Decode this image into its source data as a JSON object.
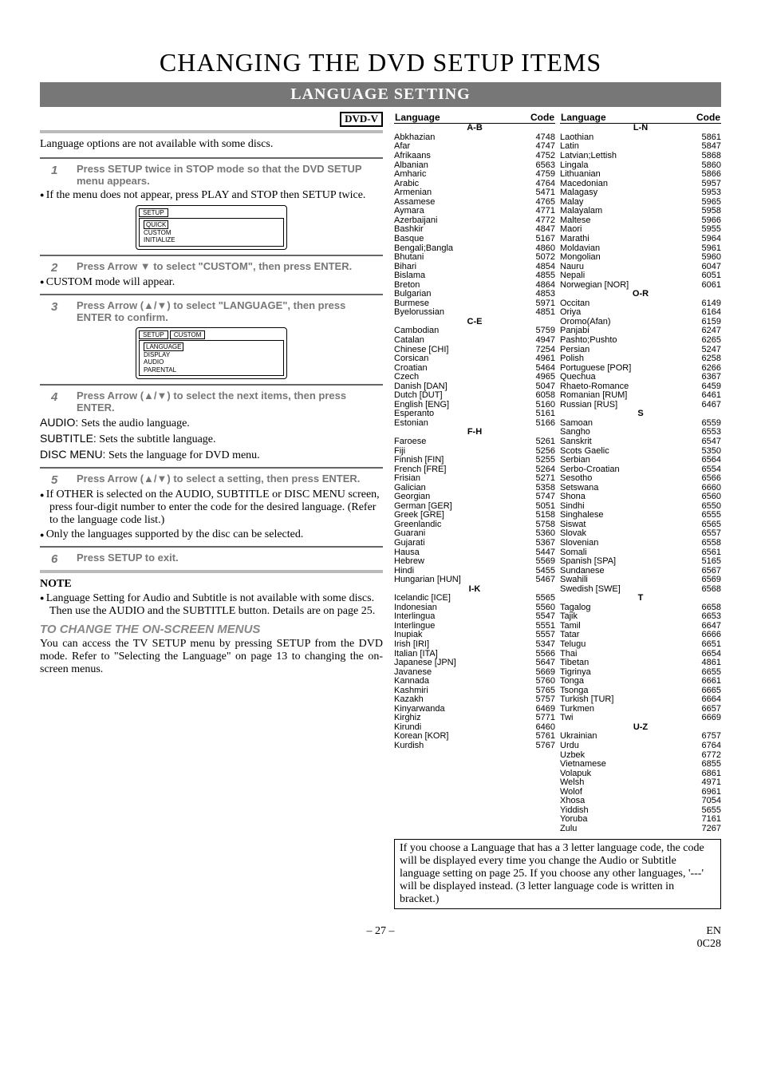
{
  "main_title": "CHANGING THE DVD SETUP ITEMS",
  "sub_title": "LANGUAGE SETTING",
  "dvd_box": "DVD-V",
  "intro": "Language options are not available with some discs.",
  "step1": "Press SETUP twice in STOP mode so that the DVD SETUP menu appears.",
  "bullet1": "If the menu does not appear, press PLAY and STOP then SETUP twice.",
  "osd1": {
    "tab": "SETUP",
    "items": [
      "QUICK",
      "CUSTOM",
      "INITIALIZE"
    ],
    "highlight": 0
  },
  "step2": "Press Arrow ▼ to select \"CUSTOM\", then press ENTER.",
  "bullet2": "CUSTOM mode will appear.",
  "step3": "Press Arrow (▲/▼) to select \"LANGUAGE\", then press ENTER to confirm.",
  "osd2": {
    "tab": "SETUP",
    "tab2": "CUSTOM",
    "items": [
      "LANGUAGE",
      "DISPLAY",
      "AUDIO",
      "PARENTAL"
    ],
    "highlight": 0
  },
  "step4": "Press Arrow (▲/▼) to select the next items, then press ENTER.",
  "def_audio_label": "AUDIO:",
  "def_audio": "Sets the audio language.",
  "def_subtitle_label": "SUBTITLE:",
  "def_subtitle": "Sets the subtitle language.",
  "def_disc_label": "DISC MENU:",
  "def_disc": "Sets the language for DVD menu.",
  "step5": "Press Arrow (▲/▼) to select a setting, then press ENTER.",
  "bullet5a": "If OTHER is selected on the AUDIO, SUBTITLE or DISC MENU screen, press four-digit number to enter the code for the desired language. (Refer to the language code list.)",
  "bullet5b": "Only the languages supported by the disc can be selected.",
  "step6": "Press SETUP to exit.",
  "note_head": "NOTE",
  "note_bullet": "Language Setting for Audio and Subtitle is not available with some discs. Then use the AUDIO and the SUBTITLE button. Details are on page 25.",
  "change_head": "TO CHANGE THE ON-SCREEN MENUS",
  "change_body": "You can access the TV SETUP menu by pressing SETUP from the DVD mode. Refer to \"Selecting the Language\" on page 13 to changing the on-screen menus.",
  "table_head_lang": "Language",
  "table_head_code": "Code",
  "sections": {
    "ab": "A-B",
    "ce": "C-E",
    "fh": "F-H",
    "ik": "I-K",
    "ln": "L-N",
    "or": "O-R",
    "s": "S",
    "t": "T",
    "uz": "U-Z"
  },
  "chart_data": {
    "type": "table",
    "title": "Language Code List",
    "columns": [
      "Language",
      "Code"
    ],
    "left_column": [
      {
        "section": "A-B"
      },
      {
        "n": "Abkhazian",
        "c": "4748"
      },
      {
        "n": "Afar",
        "c": "4747"
      },
      {
        "n": "Afrikaans",
        "c": "4752"
      },
      {
        "n": "Albanian",
        "c": "6563"
      },
      {
        "n": "Amharic",
        "c": "4759"
      },
      {
        "n": "Arabic",
        "c": "4764"
      },
      {
        "n": "Armenian",
        "c": "5471"
      },
      {
        "n": "Assamese",
        "c": "4765"
      },
      {
        "n": "Aymara",
        "c": "4771"
      },
      {
        "n": "Azerbaijani",
        "c": "4772"
      },
      {
        "n": "Bashkir",
        "c": "4847"
      },
      {
        "n": "Basque",
        "c": "5167"
      },
      {
        "n": "Bengali;Bangla",
        "c": "4860"
      },
      {
        "n": "Bhutani",
        "c": "5072"
      },
      {
        "n": "Bihari",
        "c": "4854"
      },
      {
        "n": "Bislama",
        "c": "4855"
      },
      {
        "n": "Breton",
        "c": "4864"
      },
      {
        "n": "Bulgarian",
        "c": "4853"
      },
      {
        "n": "Burmese",
        "c": "5971"
      },
      {
        "n": "Byelorussian",
        "c": "4851"
      },
      {
        "section": "C-E"
      },
      {
        "n": "Cambodian",
        "c": "5759"
      },
      {
        "n": "Catalan",
        "c": "4947"
      },
      {
        "n": "Chinese [CHI]",
        "c": "7254"
      },
      {
        "n": "Corsican",
        "c": "4961"
      },
      {
        "n": "Croatian",
        "c": "5464"
      },
      {
        "n": "Czech",
        "c": "4965"
      },
      {
        "n": "Danish [DAN]",
        "c": "5047"
      },
      {
        "n": "Dutch [DUT]",
        "c": "6058"
      },
      {
        "n": "English [ENG]",
        "c": "5160"
      },
      {
        "n": "Esperanto",
        "c": "5161"
      },
      {
        "n": "Estonian",
        "c": "5166"
      },
      {
        "section": "F-H"
      },
      {
        "n": "Faroese",
        "c": "5261"
      },
      {
        "n": "Fiji",
        "c": "5256"
      },
      {
        "n": "Finnish [FIN]",
        "c": "5255"
      },
      {
        "n": "French [FRE]",
        "c": "5264"
      },
      {
        "n": "Frisian",
        "c": "5271"
      },
      {
        "n": "Galician",
        "c": "5358"
      },
      {
        "n": "Georgian",
        "c": "5747"
      },
      {
        "n": "German [GER]",
        "c": "5051"
      },
      {
        "n": "Greek [GRE]",
        "c": "5158"
      },
      {
        "n": "Greenlandic",
        "c": "5758"
      },
      {
        "n": "Guarani",
        "c": "5360"
      },
      {
        "n": "Gujarati",
        "c": "5367"
      },
      {
        "n": "Hausa",
        "c": "5447"
      },
      {
        "n": "Hebrew",
        "c": "5569"
      },
      {
        "n": "Hindi",
        "c": "5455"
      },
      {
        "n": "Hungarian [HUN]",
        "c": "5467"
      },
      {
        "section": "I-K"
      },
      {
        "n": "Icelandic [ICE]",
        "c": "5565"
      },
      {
        "n": "Indonesian",
        "c": "5560"
      },
      {
        "n": "Interlingua",
        "c": "5547"
      },
      {
        "n": "Interlingue",
        "c": "5551"
      },
      {
        "n": "Inupiak",
        "c": "5557"
      },
      {
        "n": "Irish [IRI]",
        "c": "5347"
      },
      {
        "n": "Italian [ITA]",
        "c": "5566"
      },
      {
        "n": "Japanese [JPN]",
        "c": "5647"
      },
      {
        "n": "Javanese",
        "c": "5669"
      },
      {
        "n": "Kannada",
        "c": "5760"
      },
      {
        "n": "Kashmiri",
        "c": "5765"
      },
      {
        "n": "Kazakh",
        "c": "5757"
      },
      {
        "n": "Kinyarwanda",
        "c": "6469"
      },
      {
        "n": "Kirghiz",
        "c": "5771"
      },
      {
        "n": "Kirundi",
        "c": "6460"
      },
      {
        "n": "Korean [KOR]",
        "c": "5761"
      },
      {
        "n": "Kurdish",
        "c": "5767"
      }
    ],
    "right_column": [
      {
        "section": "L-N"
      },
      {
        "n": "Laothian",
        "c": "5861"
      },
      {
        "n": "Latin",
        "c": "5847"
      },
      {
        "n": "Latvian;Lettish",
        "c": "5868"
      },
      {
        "n": "Lingala",
        "c": "5860"
      },
      {
        "n": "Lithuanian",
        "c": "5866"
      },
      {
        "n": "Macedonian",
        "c": "5957"
      },
      {
        "n": "Malagasy",
        "c": "5953"
      },
      {
        "n": "Malay",
        "c": "5965"
      },
      {
        "n": "Malayalam",
        "c": "5958"
      },
      {
        "n": "Maltese",
        "c": "5966"
      },
      {
        "n": "Maori",
        "c": "5955"
      },
      {
        "n": "Marathi",
        "c": "5964"
      },
      {
        "n": "Moldavian",
        "c": "5961"
      },
      {
        "n": "Mongolian",
        "c": "5960"
      },
      {
        "n": "Nauru",
        "c": "6047"
      },
      {
        "n": "Nepali",
        "c": "6051"
      },
      {
        "n": "Norwegian [NOR]",
        "c": "6061"
      },
      {
        "section": "O-R"
      },
      {
        "n": "Occitan",
        "c": "6149"
      },
      {
        "n": "Oriya",
        "c": "6164"
      },
      {
        "n": "Oromo(Afan)",
        "c": "6159"
      },
      {
        "n": "Panjabi",
        "c": "6247"
      },
      {
        "n": "Pashto;Pushto",
        "c": "6265"
      },
      {
        "n": "Persian",
        "c": "5247"
      },
      {
        "n": "Polish",
        "c": "6258"
      },
      {
        "n": "Portuguese [POR]",
        "c": "6266"
      },
      {
        "n": "Quechua",
        "c": "6367"
      },
      {
        "n": "Rhaeto-Romance",
        "c": "6459"
      },
      {
        "n": "Romanian [RUM]",
        "c": "6461"
      },
      {
        "n": "Russian [RUS]",
        "c": "6467"
      },
      {
        "section": "S"
      },
      {
        "n": "Samoan",
        "c": "6559"
      },
      {
        "n": "Sangho",
        "c": "6553"
      },
      {
        "n": "Sanskrit",
        "c": "6547"
      },
      {
        "n": "Scots Gaelic",
        "c": "5350"
      },
      {
        "n": "Serbian",
        "c": "6564"
      },
      {
        "n": "Serbo-Croatian",
        "c": "6554"
      },
      {
        "n": "Sesotho",
        "c": "6566"
      },
      {
        "n": "Setswana",
        "c": "6660"
      },
      {
        "n": "Shona",
        "c": "6560"
      },
      {
        "n": "Sindhi",
        "c": "6550"
      },
      {
        "n": "Singhalese",
        "c": "6555"
      },
      {
        "n": "Siswat",
        "c": "6565"
      },
      {
        "n": "Slovak",
        "c": "6557"
      },
      {
        "n": "Slovenian",
        "c": "6558"
      },
      {
        "n": "Somali",
        "c": "6561"
      },
      {
        "n": "Spanish [SPA]",
        "c": "5165"
      },
      {
        "n": "Sundanese",
        "c": "6567"
      },
      {
        "n": "Swahili",
        "c": "6569"
      },
      {
        "n": "Swedish [SWE]",
        "c": "6568"
      },
      {
        "section": "T"
      },
      {
        "n": "Tagalog",
        "c": "6658"
      },
      {
        "n": "Tajik",
        "c": "6653"
      },
      {
        "n": "Tamil",
        "c": "6647"
      },
      {
        "n": "Tatar",
        "c": "6666"
      },
      {
        "n": "Telugu",
        "c": "6651"
      },
      {
        "n": "Thai",
        "c": "6654"
      },
      {
        "n": "Tibetan",
        "c": "4861"
      },
      {
        "n": "Tigrinya",
        "c": "6655"
      },
      {
        "n": "Tonga",
        "c": "6661"
      },
      {
        "n": "Tsonga",
        "c": "6665"
      },
      {
        "n": "Turkish [TUR]",
        "c": "6664"
      },
      {
        "n": "Turkmen",
        "c": "6657"
      },
      {
        "n": "Twi",
        "c": "6669"
      },
      {
        "section": "U-Z"
      },
      {
        "n": "Ukrainian",
        "c": "6757"
      },
      {
        "n": "Urdu",
        "c": "6764"
      },
      {
        "n": "Uzbek",
        "c": "6772"
      },
      {
        "n": "Vietnamese",
        "c": "6855"
      },
      {
        "n": "Volapuk",
        "c": "6861"
      },
      {
        "n": "Welsh",
        "c": "4971"
      },
      {
        "n": "Wolof",
        "c": "6961"
      },
      {
        "n": "Xhosa",
        "c": "7054"
      },
      {
        "n": "Yiddish",
        "c": "5655"
      },
      {
        "n": "Yoruba",
        "c": "7161"
      },
      {
        "n": "Zulu",
        "c": "7267"
      }
    ]
  },
  "note_box": "If you choose a Language that has a 3 letter language code, the code will be displayed every time you change the Audio or Subtitle language setting on page 25. If you choose any other languages, '---' will be displayed instead. (3 letter language code is written in bracket.)",
  "footer_center": "– 27 –",
  "footer_right1": "EN",
  "footer_right2": "0C28"
}
